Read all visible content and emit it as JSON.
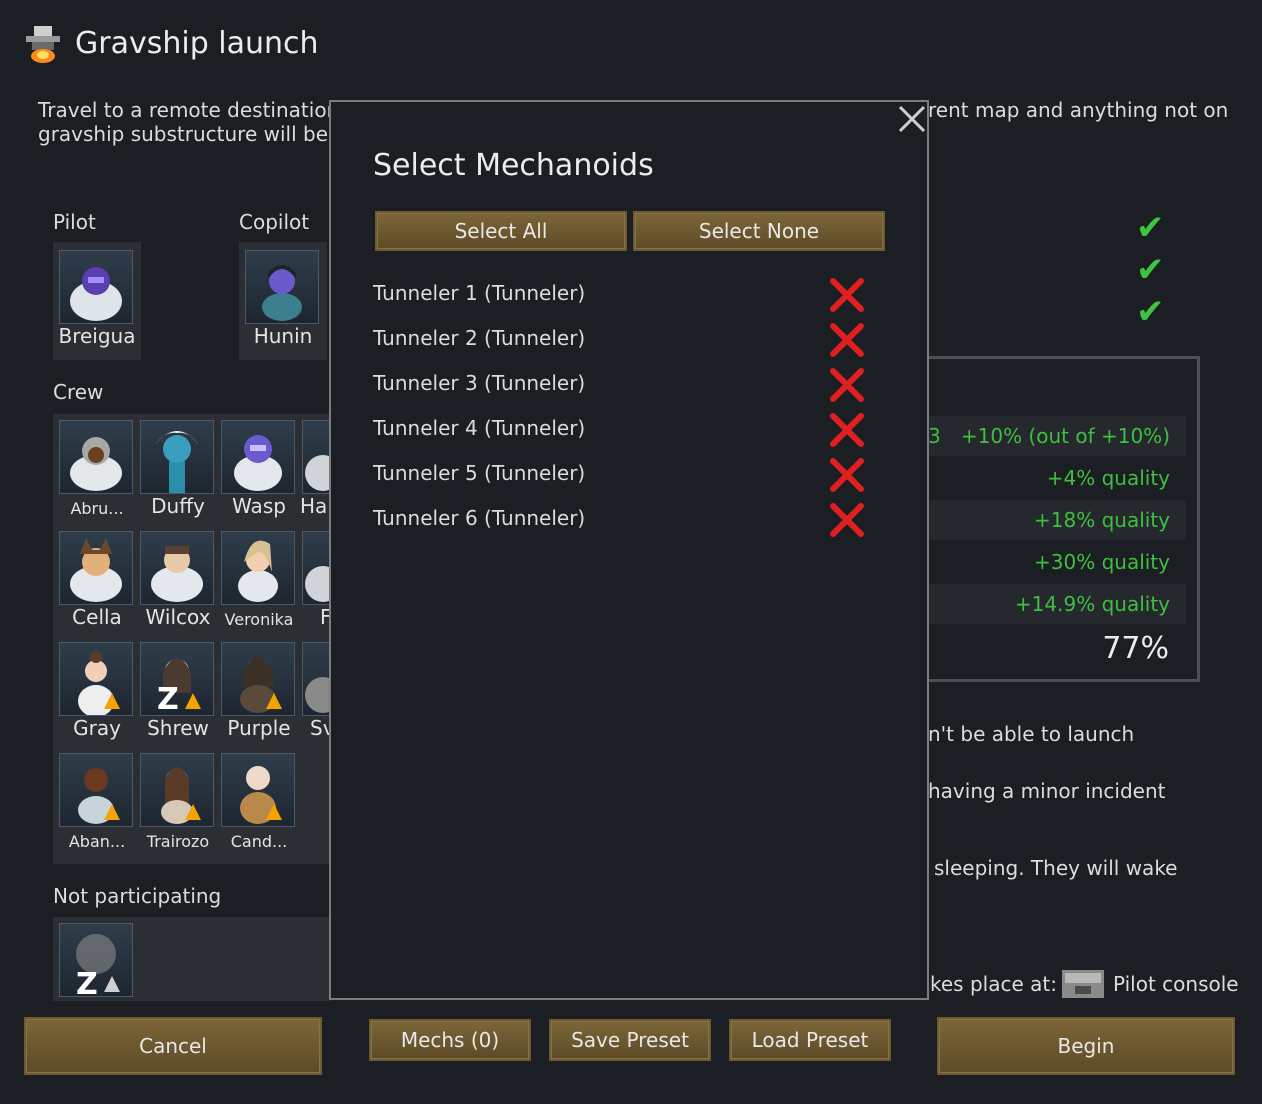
{
  "window": {
    "title": "Gravship launch",
    "desc_line1": "Travel to a remote destination",
    "desc_line2": "gravship substructure will be p",
    "desc_right": "rent map and anything not on"
  },
  "pilot": {
    "label": "Pilot",
    "name": "Breigua"
  },
  "copilot": {
    "label": "Copilot",
    "name": "Hunin"
  },
  "crew": {
    "label": "Crew",
    "members": [
      {
        "name": "Abru..."
      },
      {
        "name": "Duffy"
      },
      {
        "name": "Wasp"
      },
      {
        "name": "Ha"
      },
      {
        "name": "Cella"
      },
      {
        "name": "Wilcox"
      },
      {
        "name": "Veronika"
      },
      {
        "name": "F"
      },
      {
        "name": "Gray"
      },
      {
        "name": "Shrew"
      },
      {
        "name": "Purple"
      },
      {
        "name": "Sv"
      },
      {
        "name": "Aban..."
      },
      {
        "name": "Trairozo"
      },
      {
        "name": "Cand..."
      }
    ]
  },
  "not_participating": {
    "label": "Not participating"
  },
  "quality": {
    "rows": [
      {
        "text": "+10% (out of +10%)"
      },
      {
        "text": "+4% quality"
      },
      {
        "text": "+18% quality"
      },
      {
        "text": "+30% quality"
      },
      {
        "text": "+14.9% quality"
      }
    ],
    "total": "77%",
    "row0_prefix": "3"
  },
  "warnings": {
    "launch": "n't be able to launch",
    "incident": "having a minor incident",
    "sleeping": "sleeping. They will wake",
    "location_prefix": "kes place at:",
    "location_name": "Pilot console"
  },
  "buttons": {
    "cancel": "Cancel",
    "mechs": "Mechs (0)",
    "save_preset": "Save Preset",
    "load_preset": "Load Preset",
    "begin": "Begin"
  },
  "dialog": {
    "title": "Select Mechanoids",
    "select_all": "Select All",
    "select_none": "Select None",
    "mechs": [
      {
        "label": "Tunneler 1 (Tunneler)",
        "selected": false
      },
      {
        "label": "Tunneler 2 (Tunneler)",
        "selected": false
      },
      {
        "label": "Tunneler 3 (Tunneler)",
        "selected": false
      },
      {
        "label": "Tunneler 4 (Tunneler)",
        "selected": false
      },
      {
        "label": "Tunneler 5 (Tunneler)",
        "selected": false
      },
      {
        "label": "Tunneler 6 (Tunneler)",
        "selected": false
      }
    ]
  },
  "colors": {
    "background": "#1b1e22",
    "button_gold": "#7c6638",
    "check_green": "#3fc43f",
    "quality_green": "#3fbf3f",
    "cross_red": "#e02020"
  },
  "icons": {
    "title": "gravship-icon",
    "close": "close-icon",
    "check": "check-icon",
    "cross": "cross-icon",
    "console": "pilot-console-icon"
  }
}
